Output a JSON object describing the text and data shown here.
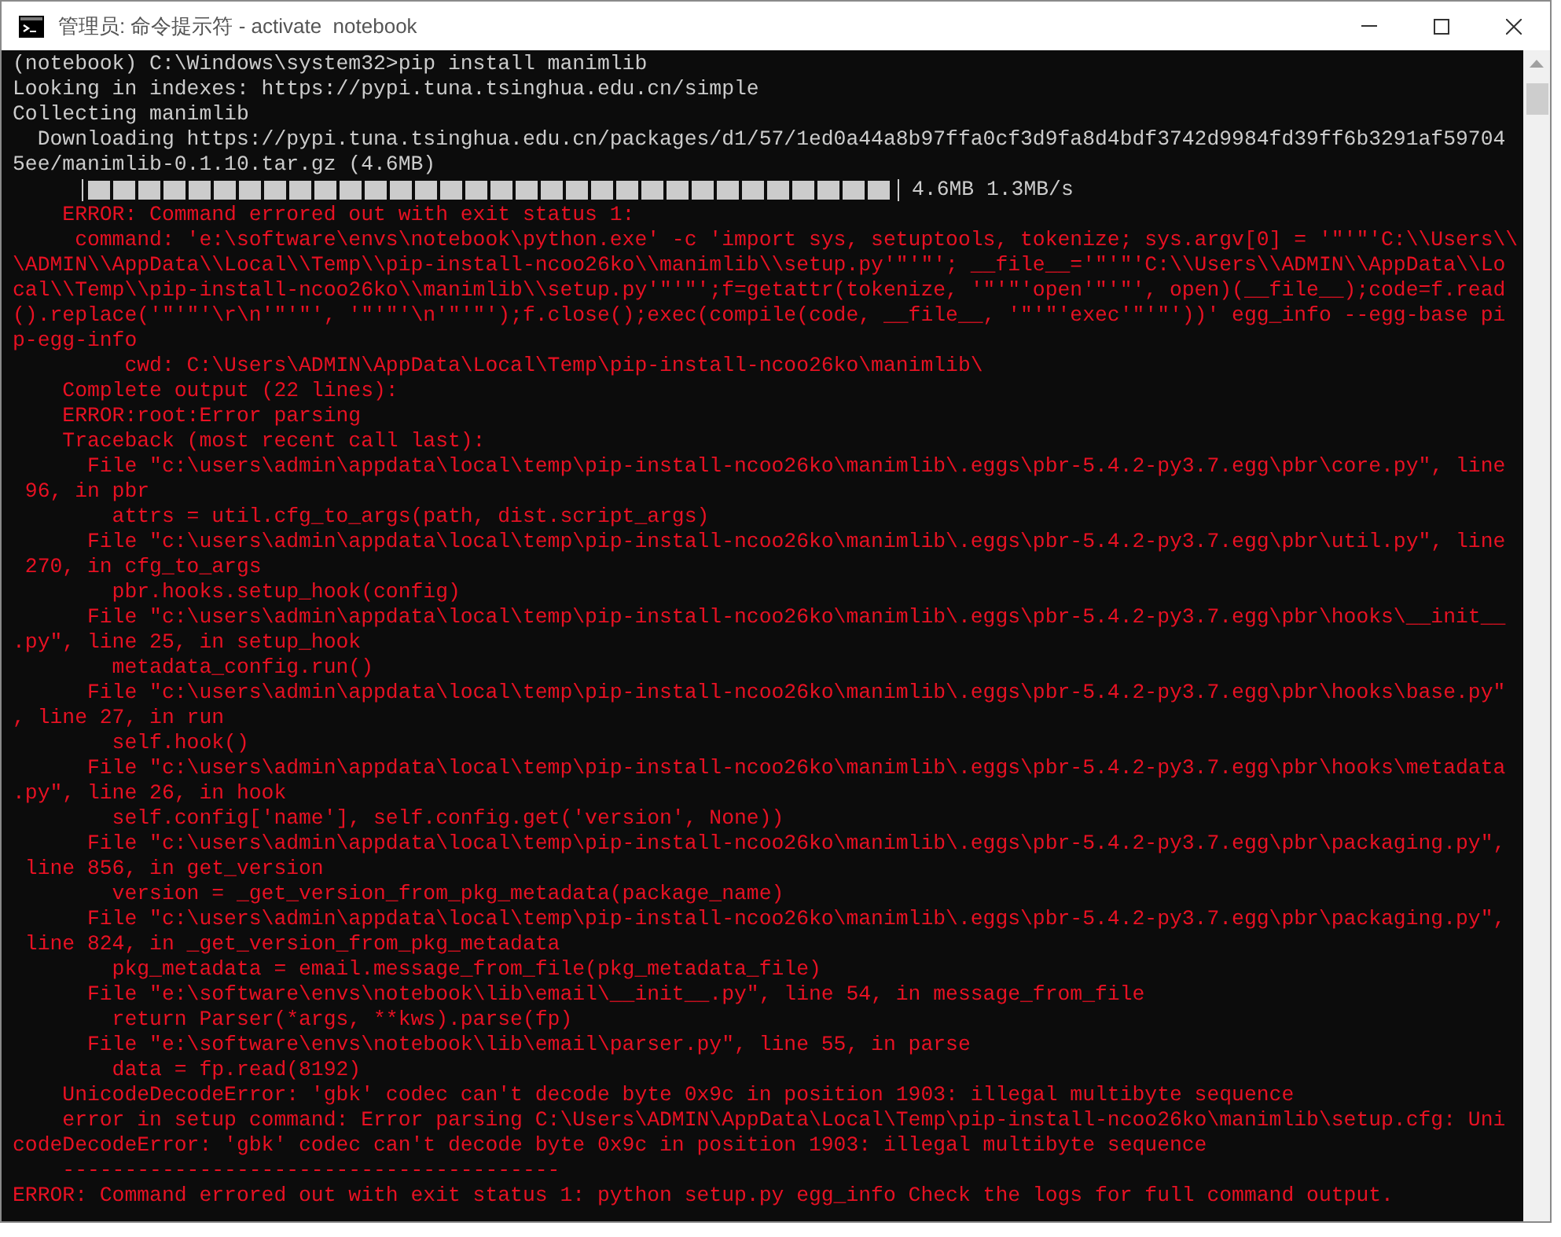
{
  "window": {
    "title": "管理员: 命令提示符 - activate  notebook"
  },
  "console": {
    "lines": [
      {
        "kind": "normal",
        "text": "(notebook) C:\\Windows\\system32>pip install manimlib"
      },
      {
        "kind": "normal",
        "text": "Looking in indexes: https://pypi.tuna.tsinghua.edu.cn/simple"
      },
      {
        "kind": "normal",
        "text": "Collecting manimlib"
      },
      {
        "kind": "normal",
        "text": "  Downloading https://pypi.tuna.tsinghua.edu.cn/packages/d1/57/1ed0a44a8b97ffa0cf3d9fa8d4bdf3742d9984fd39ff6b3291af59704"
      },
      {
        "kind": "normal",
        "text": "5ee/manimlib-0.1.10.tar.gz (4.6MB)"
      },
      {
        "kind": "progress",
        "text": "4.6MB 1.3MB/s",
        "level": 1
      },
      {
        "kind": "error",
        "text": "    ERROR: Command errored out with exit status 1:"
      },
      {
        "kind": "error",
        "text": "     command: 'e:\\software\\envs\\notebook\\python.exe' -c 'import sys, setuptools, tokenize; sys.argv[0] = '\"'\"'C:\\\\Users\\\\"
      },
      {
        "kind": "error",
        "text": "\\ADMIN\\\\AppData\\\\Local\\\\Temp\\\\pip-install-ncoo26ko\\\\manimlib\\\\setup.py'\"'\"'; __file__='\"'\"'C:\\\\Users\\\\ADMIN\\\\AppData\\\\Lo"
      },
      {
        "kind": "error",
        "text": "cal\\\\Temp\\\\pip-install-ncoo26ko\\\\manimlib\\\\setup.py'\"'\"';f=getattr(tokenize, '\"'\"'open'\"'\"', open)(__file__);code=f.read"
      },
      {
        "kind": "error",
        "text": "().replace('\"'\"'\\r\\n'\"'\"', '\"'\"'\\n'\"'\"');f.close();exec(compile(code, __file__, '\"'\"'exec'\"'\"'))' egg_info --egg-base pi"
      },
      {
        "kind": "error",
        "text": "p-egg-info"
      },
      {
        "kind": "error",
        "text": "         cwd: C:\\Users\\ADMIN\\AppData\\Local\\Temp\\pip-install-ncoo26ko\\manimlib\\"
      },
      {
        "kind": "error",
        "text": "    Complete output (22 lines):"
      },
      {
        "kind": "error",
        "text": "    ERROR:root:Error parsing"
      },
      {
        "kind": "error",
        "text": "    Traceback (most recent call last):"
      },
      {
        "kind": "error",
        "text": "      File \"c:\\users\\admin\\appdata\\local\\temp\\pip-install-ncoo26ko\\manimlib\\.eggs\\pbr-5.4.2-py3.7.egg\\pbr\\core.py\", line"
      },
      {
        "kind": "error",
        "text": " 96, in pbr"
      },
      {
        "kind": "error",
        "text": "        attrs = util.cfg_to_args(path, dist.script_args)"
      },
      {
        "kind": "error",
        "text": "      File \"c:\\users\\admin\\appdata\\local\\temp\\pip-install-ncoo26ko\\manimlib\\.eggs\\pbr-5.4.2-py3.7.egg\\pbr\\util.py\", line"
      },
      {
        "kind": "error",
        "text": " 270, in cfg_to_args"
      },
      {
        "kind": "error",
        "text": "        pbr.hooks.setup_hook(config)"
      },
      {
        "kind": "error",
        "text": "      File \"c:\\users\\admin\\appdata\\local\\temp\\pip-install-ncoo26ko\\manimlib\\.eggs\\pbr-5.4.2-py3.7.egg\\pbr\\hooks\\__init__"
      },
      {
        "kind": "error",
        "text": ".py\", line 25, in setup_hook"
      },
      {
        "kind": "error",
        "text": "        metadata_config.run()"
      },
      {
        "kind": "error",
        "text": "      File \"c:\\users\\admin\\appdata\\local\\temp\\pip-install-ncoo26ko\\manimlib\\.eggs\\pbr-5.4.2-py3.7.egg\\pbr\\hooks\\base.py\""
      },
      {
        "kind": "error",
        "text": ", line 27, in run"
      },
      {
        "kind": "error",
        "text": "        self.hook()"
      },
      {
        "kind": "error",
        "text": "      File \"c:\\users\\admin\\appdata\\local\\temp\\pip-install-ncoo26ko\\manimlib\\.eggs\\pbr-5.4.2-py3.7.egg\\pbr\\hooks\\metadata"
      },
      {
        "kind": "error",
        "text": ".py\", line 26, in hook"
      },
      {
        "kind": "error",
        "text": "        self.config['name'], self.config.get('version', None))"
      },
      {
        "kind": "error",
        "text": "      File \"c:\\users\\admin\\appdata\\local\\temp\\pip-install-ncoo26ko\\manimlib\\.eggs\\pbr-5.4.2-py3.7.egg\\pbr\\packaging.py\","
      },
      {
        "kind": "error",
        "text": " line 856, in get_version"
      },
      {
        "kind": "error",
        "text": "        version = _get_version_from_pkg_metadata(package_name)"
      },
      {
        "kind": "error",
        "text": "      File \"c:\\users\\admin\\appdata\\local\\temp\\pip-install-ncoo26ko\\manimlib\\.eggs\\pbr-5.4.2-py3.7.egg\\pbr\\packaging.py\","
      },
      {
        "kind": "error",
        "text": " line 824, in _get_version_from_pkg_metadata"
      },
      {
        "kind": "error",
        "text": "        pkg_metadata = email.message_from_file(pkg_metadata_file)"
      },
      {
        "kind": "error",
        "text": "      File \"e:\\software\\envs\\notebook\\lib\\email\\__init__.py\", line 54, in message_from_file"
      },
      {
        "kind": "error",
        "text": "        return Parser(*args, **kws).parse(fp)"
      },
      {
        "kind": "error",
        "text": "      File \"e:\\software\\envs\\notebook\\lib\\email\\parser.py\", line 55, in parse"
      },
      {
        "kind": "error",
        "text": "        data = fp.read(8192)"
      },
      {
        "kind": "error",
        "text": "    UnicodeDecodeError: 'gbk' codec can't decode byte 0x9c in position 1903: illegal multibyte sequence"
      },
      {
        "kind": "error",
        "text": "    error in setup command: Error parsing C:\\Users\\ADMIN\\AppData\\Local\\Temp\\pip-install-ncoo26ko\\manimlib\\setup.cfg: Uni"
      },
      {
        "kind": "error",
        "text": "codeDecodeError: 'gbk' codec can't decode byte 0x9c in position 1903: illegal multibyte sequence"
      },
      {
        "kind": "error",
        "text": "    ----------------------------------------"
      },
      {
        "kind": "error",
        "text": "ERROR: Command errored out with exit status 1: python setup.py egg_info Check the logs for full command output."
      }
    ]
  }
}
